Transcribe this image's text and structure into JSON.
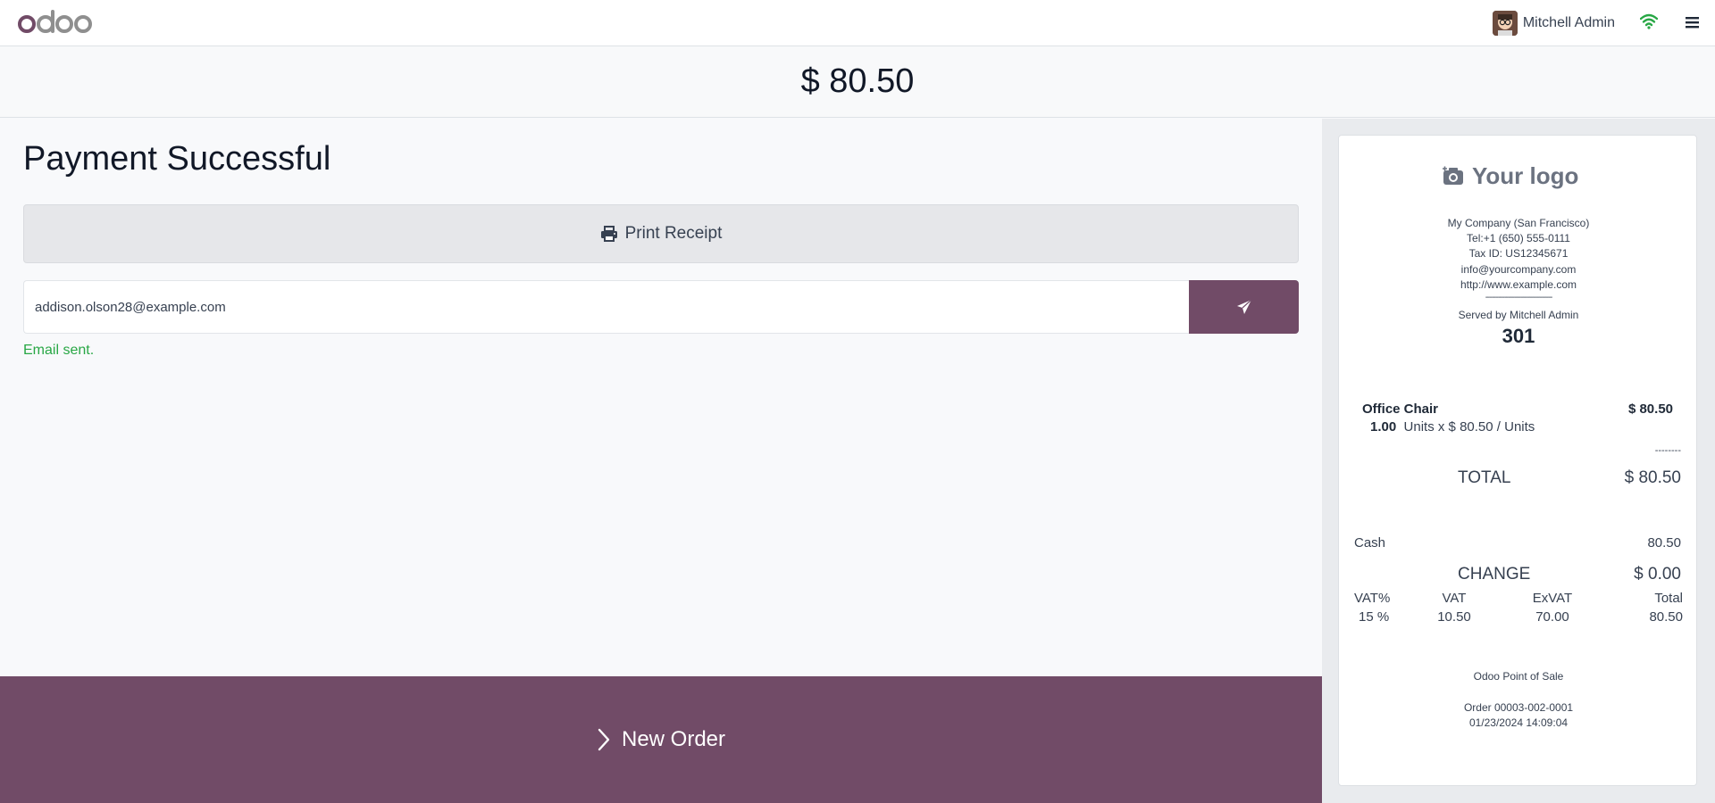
{
  "header": {
    "user_name": "Mitchell Admin"
  },
  "amount_bar": {
    "amount": "$ 80.50"
  },
  "payment": {
    "title": "Payment Successful",
    "print_label": "Print Receipt",
    "email_value": "addison.olson28@example.com",
    "email_status": "Email sent."
  },
  "new_order": {
    "label": "New Order"
  },
  "receipt": {
    "logo_text": "Your logo",
    "company": "My Company (San Francisco)",
    "tel": "Tel:+1 (650) 555-0111",
    "tax_id": "Tax ID: US12345671",
    "email": "info@yourcompany.com",
    "website": "http://www.example.com",
    "separator": "--------------------------------",
    "served_by": "Served by Mitchell Admin",
    "order_number": "301",
    "line": {
      "name": "Office Chair",
      "price": "$ 80.50",
      "qty": "1.00",
      "qty_detail": "Units x $ 80.50 / Units"
    },
    "line_separator": "--------",
    "total_label": "TOTAL",
    "total_value": "$ 80.50",
    "cash_label": "Cash",
    "cash_value": "80.50",
    "change_label": "CHANGE",
    "change_value": "$ 0.00",
    "tax_headers": [
      "VAT%",
      "VAT",
      "ExVAT",
      "Total"
    ],
    "tax_row": [
      "15 %",
      "10.50",
      "70.00",
      "80.50"
    ],
    "footer_pos": "Odoo Point of Sale",
    "footer_order": "Order 00003-002-0001",
    "footer_datetime": "01/23/2024 14:09:04"
  },
  "colors": {
    "brand": "#714b67",
    "success": "#28a745",
    "wifi": "#28a745"
  },
  "icons": {
    "logo": "odoo-logo",
    "wifi": "wifi-icon",
    "menu": "hamburger-menu-icon",
    "print": "printer-icon",
    "send": "paper-plane-icon",
    "new_order": "chevron-right-icon",
    "camera": "camera-icon"
  }
}
